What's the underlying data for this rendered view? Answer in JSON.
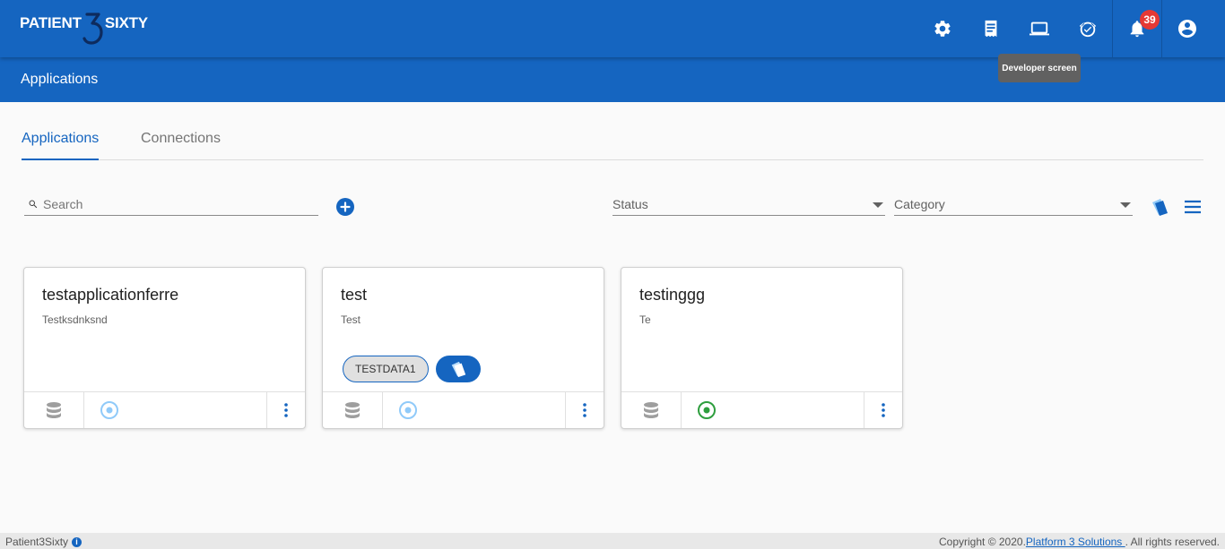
{
  "app": {
    "logo_left": "PATIENT",
    "logo_right": "SIXTY"
  },
  "topbar": {
    "icons": [
      "gear-icon",
      "receipt-icon",
      "laptop-icon",
      "alarm-check-icon",
      "bell-icon",
      "account-circle-icon"
    ],
    "notification_count": "39",
    "tooltip": "Developer screen"
  },
  "subbar": {
    "title": "Applications"
  },
  "tabs": [
    {
      "label": "Applications",
      "active": true
    },
    {
      "label": "Connections",
      "active": false
    }
  ],
  "filters": {
    "search_placeholder": "Search",
    "status_label": "Status",
    "category_label": "Category"
  },
  "cards": [
    {
      "name": "testapplicationferre",
      "description": "Testksdnksnd",
      "chips": [],
      "status_color": "#90caf9"
    },
    {
      "name": "test",
      "description": "Test",
      "chips": [
        "TESTDATA1"
      ],
      "status_color": "#90caf9"
    },
    {
      "name": "testinggg",
      "description": "Te",
      "chips": [],
      "status_color": "#2e9e3e"
    }
  ],
  "footer": {
    "app_name": "Patient3Sixty",
    "copyright_prefix": "Copyright © 2020.",
    "company_link": "Platform 3 Solutions ",
    "copyright_suffix": ". All rights reserved."
  },
  "colors": {
    "primary": "#1565c0",
    "badge": "#e53935",
    "active_status": "#2e9e3e",
    "inactive_status": "#90caf9"
  }
}
